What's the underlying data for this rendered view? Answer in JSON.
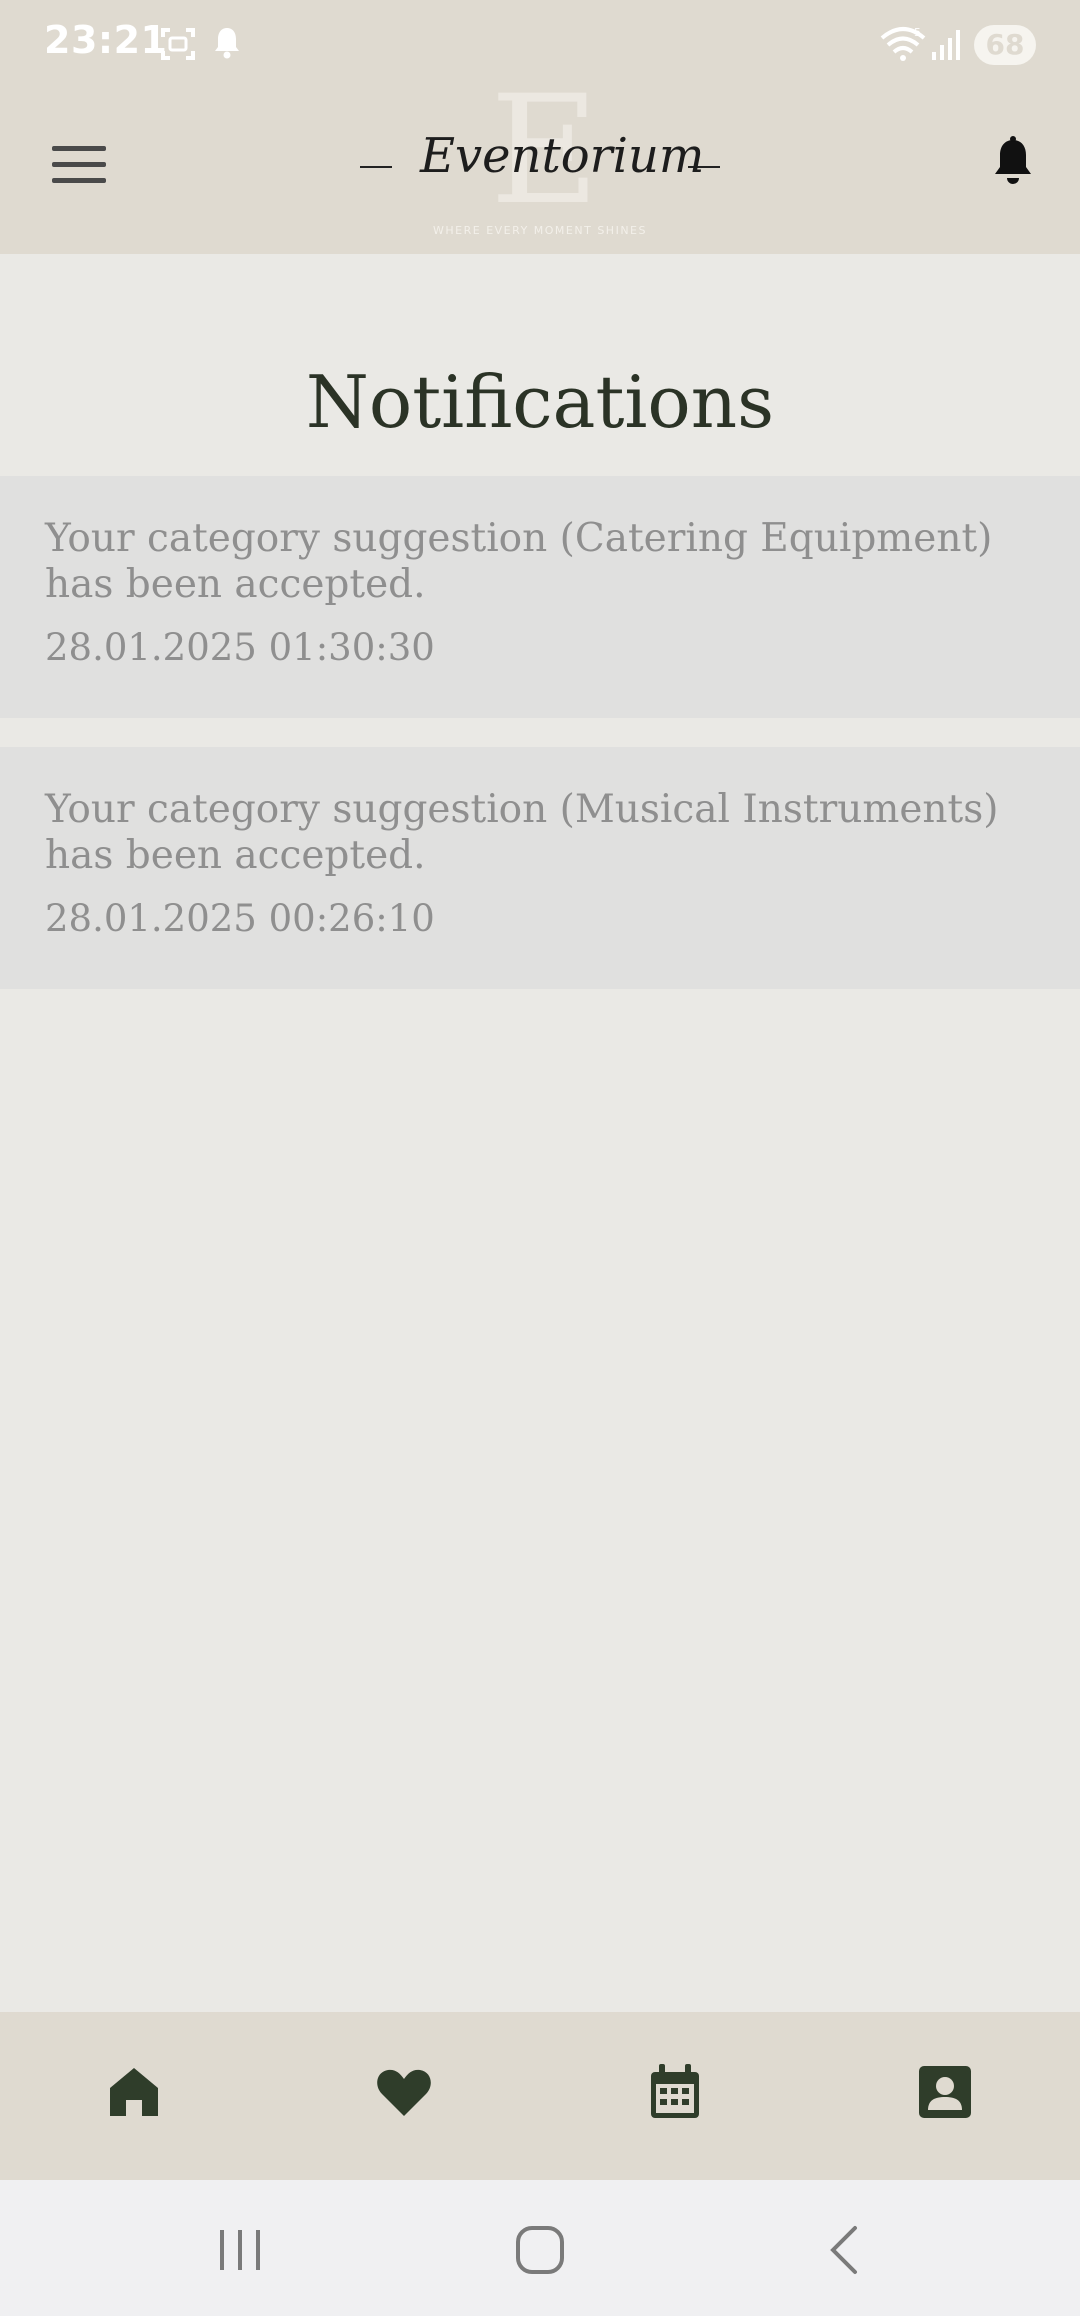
{
  "status_bar": {
    "time": "23:21",
    "battery": "68",
    "icons": [
      "screenshot-icon",
      "notification-bell-icon",
      "wifi-icon",
      "signal-icon",
      "battery-icon"
    ]
  },
  "header": {
    "logo_text": "Eventorium",
    "logo_letter": "E",
    "tagline": "WHERE EVERY MOMENT SHINES",
    "menu_icon": "hamburger-menu-icon",
    "bell_icon": "bell-icon"
  },
  "page": {
    "title": "Notifications"
  },
  "notifications": [
    {
      "message": "Your category suggestion (Catering Equipment) has been accepted.",
      "timestamp": "28.01.2025 01:30:30"
    },
    {
      "message": "Your category suggestion (Musical Instruments) has been accepted.",
      "timestamp": "28.01.2025 00:26:10"
    }
  ],
  "bottom_nav": {
    "items": [
      "home-icon",
      "favorites-heart-icon",
      "calendar-icon",
      "profile-icon"
    ]
  },
  "system_nav": {
    "items": [
      "recent-apps-icon",
      "home-circle-icon",
      "back-icon"
    ]
  },
  "colors": {
    "header_bg": "#dfdad0",
    "page_bg": "#eae9e5",
    "card_bg": "#e0e0df",
    "accent_dark_green": "#2f3d2a",
    "muted_text": "#8f8f8f"
  }
}
